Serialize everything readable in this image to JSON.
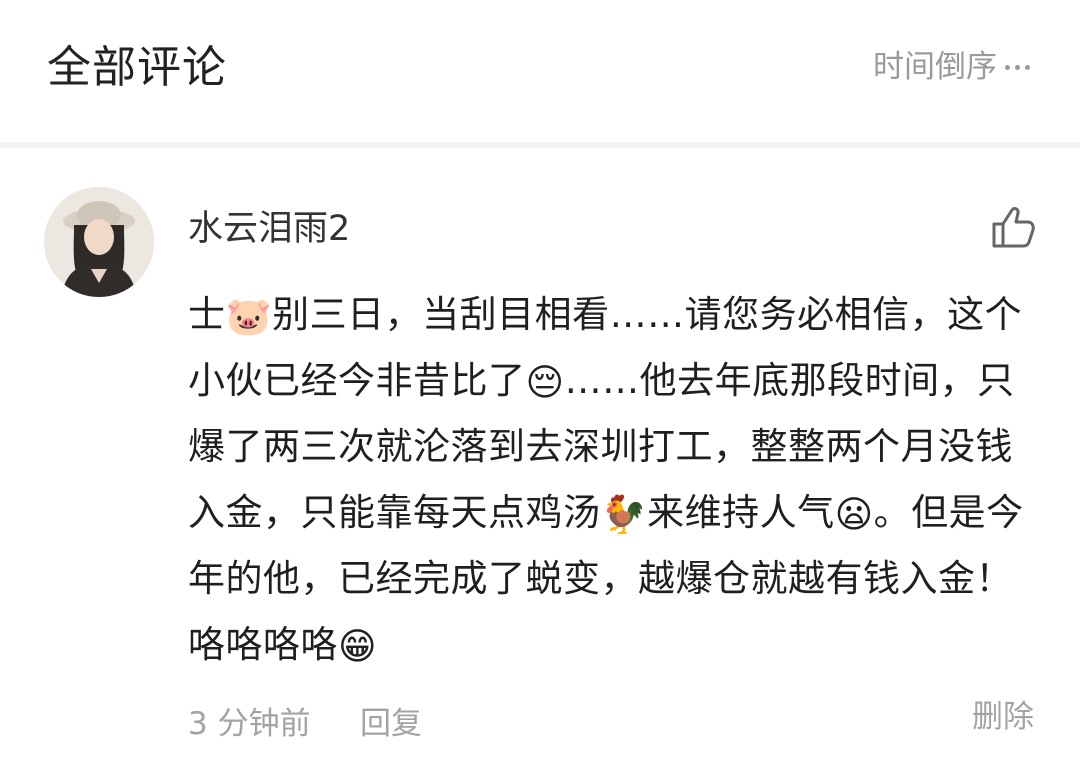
{
  "header": {
    "title": "全部评论",
    "sort_label": "时间倒序",
    "more_icon": "ellipsis-icon"
  },
  "comment": {
    "username": "水云泪雨2",
    "avatar_icon": "user-avatar",
    "like_icon": "thumbs-up-icon",
    "text_parts": {
      "p1": "士",
      "e1": "🐷",
      "p2": "别三日，当刮目相看……请您务必相信，这个小伙已经今非昔比了",
      "e2": "😔",
      "p3": "……他去年底那段时间，只爆了两三次就沦落到去深圳打工，整整两个月没钱入金，只能靠每天点鸡汤",
      "e3": "🐓",
      "p4": "来维持人气",
      "e4": "😦",
      "p5": "。但是今年的他，已经完成了蜕变，越爆仓就越有钱入金！咯咯咯咯",
      "e5": "😁"
    },
    "time": "3 分钟前",
    "reply_label": "回复",
    "delete_label": "删除"
  },
  "colors": {
    "primary_text": "#222222",
    "secondary_text": "#a3a3a3",
    "divider": "#f3f3f3"
  }
}
